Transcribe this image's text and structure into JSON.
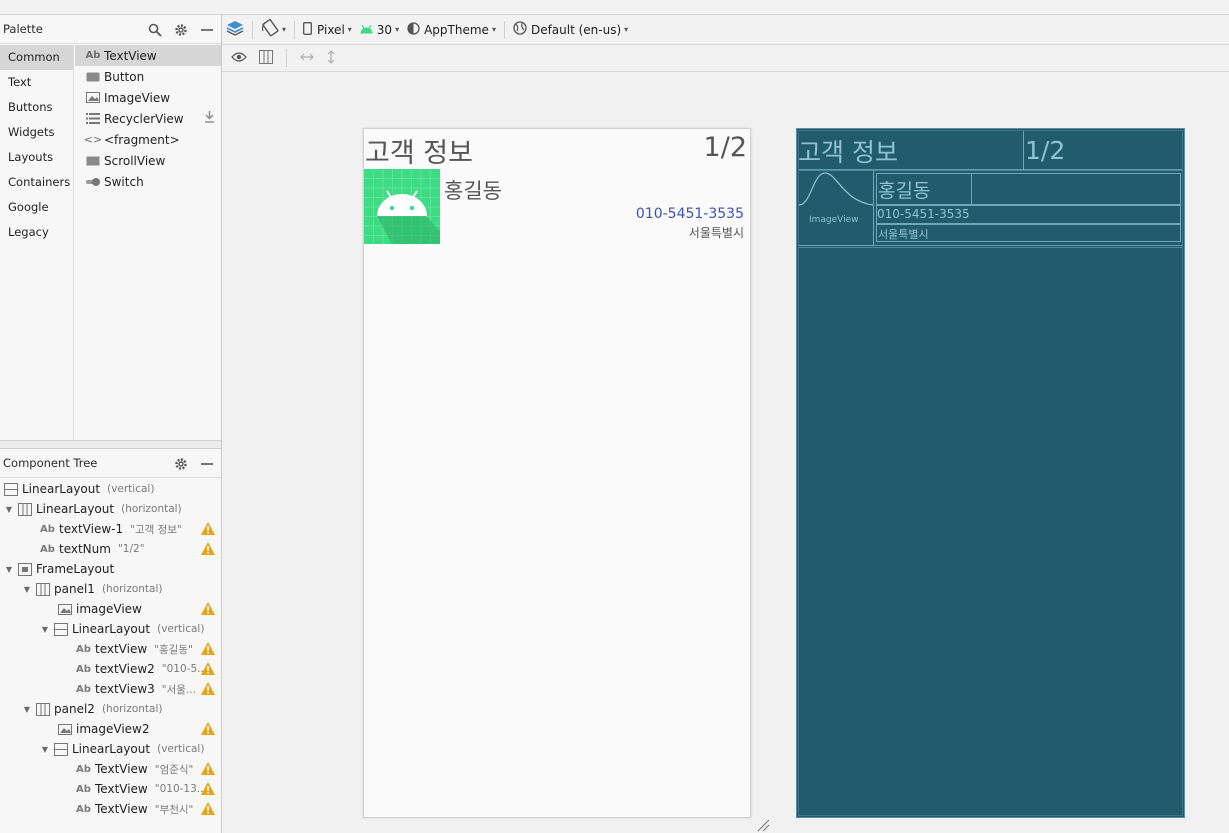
{
  "palette": {
    "title": "Palette",
    "categories": [
      "Common",
      "Text",
      "Buttons",
      "Widgets",
      "Layouts",
      "Containers",
      "Google",
      "Legacy"
    ],
    "selected_category": "Common",
    "widgets": [
      {
        "label": "TextView",
        "icon": "textview-icon"
      },
      {
        "label": "Button",
        "icon": "button-icon"
      },
      {
        "label": "ImageView",
        "icon": "imageview-icon"
      },
      {
        "label": "RecyclerView",
        "icon": "recyclerview-icon"
      },
      {
        "label": "<fragment>",
        "icon": "fragment-icon"
      },
      {
        "label": "ScrollView",
        "icon": "scrollview-icon"
      },
      {
        "label": "Switch",
        "icon": "switch-icon"
      }
    ]
  },
  "component_tree": {
    "title": "Component Tree",
    "rows": [
      {
        "label": "LinearLayout",
        "note": "(vertical)"
      },
      {
        "label": "LinearLayout",
        "note": "(horizontal)"
      },
      {
        "label": "textView-1",
        "note": "\"고객 정보\""
      },
      {
        "label": "textNum",
        "note": "\"1/2\""
      },
      {
        "label": "FrameLayout",
        "note": ""
      },
      {
        "label": "panel1",
        "note": "(horizontal)"
      },
      {
        "label": "imageView",
        "note": ""
      },
      {
        "label": "LinearLayout",
        "note": "(vertical)"
      },
      {
        "label": "textView",
        "note": "\"홍길동\""
      },
      {
        "label": "textView2",
        "note": "\"010-5..."
      },
      {
        "label": "textView3",
        "note": "\"서울..."
      },
      {
        "label": "panel2",
        "note": "(horizontal)"
      },
      {
        "label": "imageView2",
        "note": ""
      },
      {
        "label": "LinearLayout",
        "note": "(vertical)"
      },
      {
        "label": "TextView",
        "note": "\"엄준식\""
      },
      {
        "label": "TextView",
        "note": "\"010-13..."
      },
      {
        "label": "TextView",
        "note": "\"부천시\""
      }
    ]
  },
  "toolbar": {
    "device": "Pixel",
    "api": "30",
    "theme": "AppTheme",
    "locale": "Default (en-us)"
  },
  "design": {
    "title": "고객 정보",
    "num": "1/2",
    "name": "홍길동",
    "phone": "010-5451-3535",
    "city": "서울특별시"
  },
  "blueprint": {
    "title": "고객 정보",
    "num": "1/2",
    "image_label": "ImageView",
    "name": "홍길동",
    "phone": "010-5451-3535",
    "city": "서울특별시"
  },
  "colors": {
    "accent": "#3ddc84",
    "phone_text": "#3f51b5",
    "blueprint_bg": "#235b6e",
    "warning": "#e8a317"
  }
}
